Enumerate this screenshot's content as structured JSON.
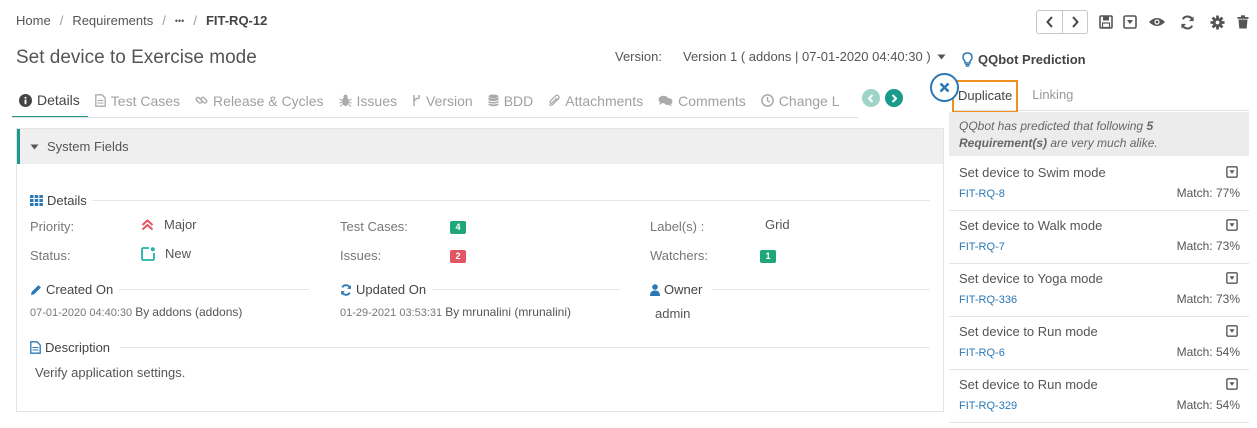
{
  "breadcrumb": {
    "home": "Home",
    "section": "Requirements",
    "ellipsis": "•••",
    "current": "FIT-RQ-12"
  },
  "title": "Set device to Exercise mode",
  "version": {
    "label": "Version:",
    "value": "Version 1 ( addons | 07-01-2020 04:40:30 )"
  },
  "tabs": [
    {
      "label": "Details",
      "icon": "info-icon"
    },
    {
      "label": "Test Cases",
      "icon": "document-icon"
    },
    {
      "label": "Release & Cycles",
      "icon": "link-icon"
    },
    {
      "label": "Issues",
      "icon": "bug-icon"
    },
    {
      "label": "Version",
      "icon": "branch-icon"
    },
    {
      "label": "BDD",
      "icon": "database-icon"
    },
    {
      "label": "Attachments",
      "icon": "paperclip-icon"
    },
    {
      "label": "Comments",
      "icon": "comments-icon"
    },
    {
      "label": "Change L",
      "icon": "clock-icon"
    }
  ],
  "panel": {
    "header": "System Fields",
    "details_title": "Details",
    "priority_label": "Priority:",
    "priority_value": "Major",
    "status_label": "Status:",
    "status_value": "New",
    "testcases_label": "Test Cases:",
    "testcases_count": "4",
    "issues_label": "Issues:",
    "issues_count": "2",
    "labels_label": "Label(s) :",
    "labels_value": "Grid",
    "watchers_label": "Watchers:",
    "watchers_count": "1",
    "created_title": "Created On",
    "created_date": "07-01-2020 04:40:30",
    "created_by_word": "By",
    "created_by": "addons (addons)",
    "updated_title": "Updated On",
    "updated_date": "01-29-2021 03:53:31",
    "updated_by_word": "By",
    "updated_by": "mrunalini (mrunalini)",
    "owner_title": "Owner",
    "owner_value": "admin",
    "description_title": "Description",
    "description_value": "Verify application settings."
  },
  "sidebar": {
    "title": "QQbot Prediction",
    "tab_duplicate": "Duplicate",
    "tab_linking": "Linking",
    "note_prefix": "QQbot has predicted that following ",
    "note_bold": "5 Requirement(s)",
    "note_suffix": " are very much alike.",
    "items": [
      {
        "title": "Set device to Swim mode",
        "id": "FIT-RQ-8",
        "match": "Match: 77%"
      },
      {
        "title": "Set device to Walk mode",
        "id": "FIT-RQ-7",
        "match": "Match: 73%"
      },
      {
        "title": "Set device to Yoga mode",
        "id": "FIT-RQ-336",
        "match": "Match: 73%"
      },
      {
        "title": "Set device to Run mode",
        "id": "FIT-RQ-6",
        "match": "Match: 54%"
      },
      {
        "title": "Set device to Run mode",
        "id": "FIT-RQ-329",
        "match": "Match: 54%"
      }
    ]
  },
  "colors": {
    "accent": "#1a9a8a",
    "link": "#2a78b5",
    "highlight": "#f0901e",
    "badge_green": "#1fa67a",
    "badge_red": "#e25563",
    "priority": "#e25563"
  }
}
